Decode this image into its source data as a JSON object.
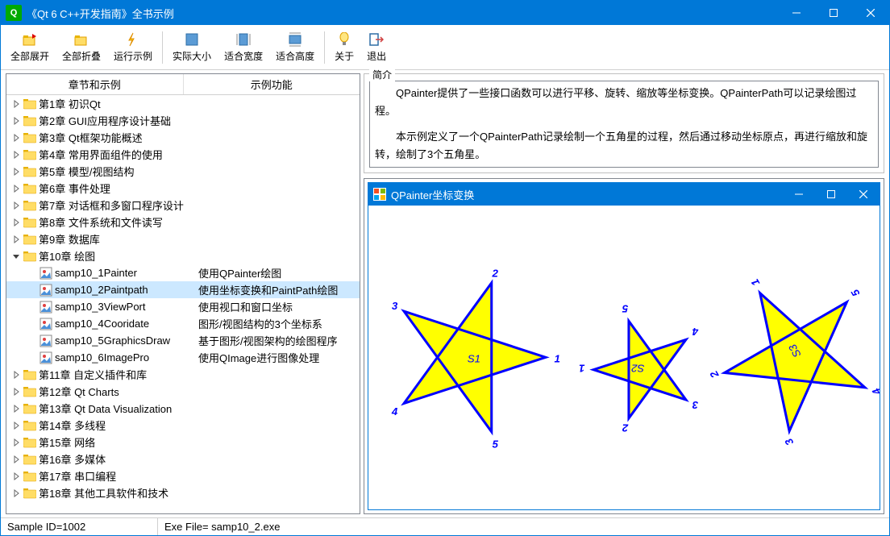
{
  "window": {
    "title": "《Qt 6 C++开发指南》全书示例"
  },
  "toolbar": {
    "expand_all": "全部展开",
    "collapse_all": "全部折叠",
    "run_sample": "运行示例",
    "actual_size": "实际大小",
    "fit_width": "适合宽度",
    "fit_height": "适合高度",
    "about": "关于",
    "exit": "退出"
  },
  "tree": {
    "header_col1": "章节和示例",
    "header_col2": "示例功能",
    "chapters": [
      {
        "label": "第1章 初识Qt",
        "expanded": false
      },
      {
        "label": "第2章 GUI应用程序设计基础",
        "expanded": false
      },
      {
        "label": "第3章 Qt框架功能概述",
        "expanded": false
      },
      {
        "label": "第4章 常用界面组件的使用",
        "expanded": false
      },
      {
        "label": "第5章 模型/视图结构",
        "expanded": false
      },
      {
        "label": "第6章 事件处理",
        "expanded": false
      },
      {
        "label": "第7章 对话框和多窗口程序设计",
        "expanded": false
      },
      {
        "label": "第8章 文件系统和文件读写",
        "expanded": false
      },
      {
        "label": "第9章 数据库",
        "expanded": false
      },
      {
        "label": "第10章 绘图",
        "expanded": true,
        "children": [
          {
            "label": "samp10_1Painter",
            "desc": "使用QPainter绘图"
          },
          {
            "label": "samp10_2Paintpath",
            "desc": "使用坐标变换和PaintPath绘图",
            "selected": true
          },
          {
            "label": "samp10_3ViewPort",
            "desc": "使用视口和窗口坐标"
          },
          {
            "label": "samp10_4Cooridate",
            "desc": "图形/视图结构的3个坐标系"
          },
          {
            "label": "samp10_5GraphicsDraw",
            "desc": "基于图形/视图架构的绘图程序"
          },
          {
            "label": "samp10_6ImagePro",
            "desc": "使用QImage进行图像处理"
          }
        ]
      },
      {
        "label": "第11章 自定义插件和库",
        "expanded": false
      },
      {
        "label": "第12章 Qt Charts",
        "expanded": false
      },
      {
        "label": "第13章 Qt Data Visualization",
        "expanded": false
      },
      {
        "label": "第14章 多线程",
        "expanded": false
      },
      {
        "label": "第15章 网络",
        "expanded": false
      },
      {
        "label": "第16章 多媒体",
        "expanded": false
      },
      {
        "label": "第17章 串口编程",
        "expanded": false
      },
      {
        "label": "第18章 其他工具软件和技术",
        "expanded": false
      }
    ]
  },
  "intro": {
    "legend": "简介",
    "p1": "　　QPainter提供了一些接口函数可以进行平移、旋转、缩放等坐标变换。QPainterPath可以记录绘图过程。",
    "p2": "　　本示例定义了一个QPainterPath记录绘制一个五角星的过程，然后通过移动坐标原点，再进行缩放和旋转，绘制了3个五角星。"
  },
  "preview": {
    "title": "QPainter坐标变换",
    "stars": [
      {
        "label": "S1",
        "scale": 1.0,
        "rotate": 0
      },
      {
        "label": "S2",
        "scale": 0.7,
        "rotate": 180
      },
      {
        "label": "S3",
        "scale": 1.0,
        "rotate": -120
      }
    ],
    "point_labels": [
      "1",
      "2",
      "3",
      "4",
      "5"
    ]
  },
  "status": {
    "sample_id": "Sample ID=1002",
    "exe_file": "Exe File= samp10_2.exe"
  },
  "colors": {
    "accent": "#0078d7",
    "star_fill": "#ffff00",
    "star_stroke": "#0000ff"
  }
}
